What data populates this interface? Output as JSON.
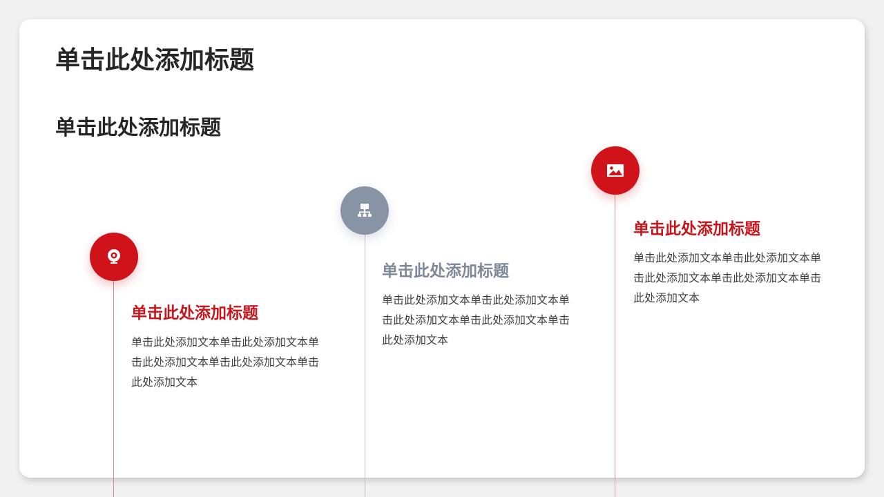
{
  "slide": {
    "title": "单击此处添加标题",
    "subtitle": "单击此处添加标题"
  },
  "colors": {
    "accent_red": "#d0131a",
    "accent_gray": "#8893a6",
    "text_dark": "#262626"
  },
  "items": [
    {
      "icon": "webcam-icon",
      "title": "单击此处添加标题",
      "text": "单击此处添加文本单击此处添加文本单击此处添加文本单击此处添加文本单击此处添加文本"
    },
    {
      "icon": "hierarchy-icon",
      "title": "单击此处添加标题",
      "text": "单击此处添加文本单击此处添加文本单击此处添加文本单击此处添加文本单击此处添加文本"
    },
    {
      "icon": "image-icon",
      "title": "单击此处添加标题",
      "text": "单击此处添加文本单击此处添加文本单击此处添加文本单击此处添加文本单击此处添加文本"
    }
  ]
}
